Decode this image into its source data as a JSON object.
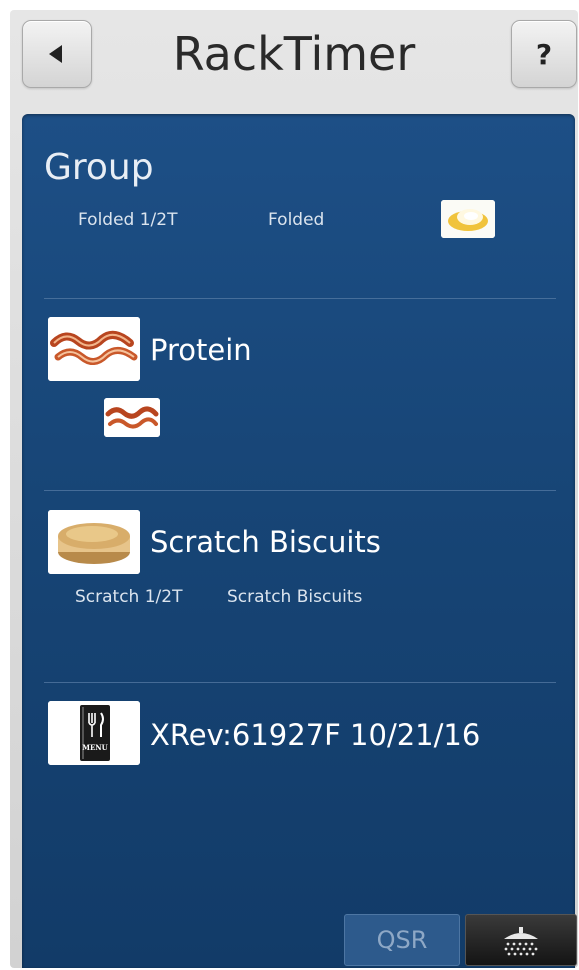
{
  "header": {
    "title": "RackTimer",
    "help_label": "?"
  },
  "sections": {
    "group": {
      "title": "Group",
      "items": [
        "Folded 1/2T",
        "Folded"
      ]
    },
    "protein": {
      "title": "Protein"
    },
    "biscuits": {
      "title": "Scratch Biscuits",
      "items": [
        "Scratch 1/2T",
        "Scratch Biscuits"
      ]
    },
    "version": {
      "title": "XRev:61927F 10/21/16",
      "menu_icon_text": "MENU"
    }
  },
  "footer": {
    "qsr_label": "QSR"
  },
  "colors": {
    "panel": "#174576",
    "title_bar": "#dcdcdc"
  }
}
